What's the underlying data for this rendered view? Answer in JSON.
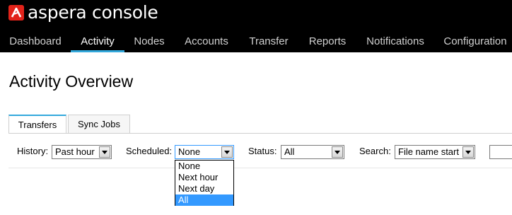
{
  "brand": {
    "name": "aspera console"
  },
  "nav": {
    "items": [
      {
        "label": "Dashboard",
        "active": false
      },
      {
        "label": "Activity",
        "active": true
      },
      {
        "label": "Nodes",
        "active": false
      },
      {
        "label": "Accounts",
        "active": false
      },
      {
        "label": "Transfer",
        "active": false
      },
      {
        "label": "Reports",
        "active": false
      },
      {
        "label": "Notifications",
        "active": false
      },
      {
        "label": "Configuration",
        "active": false
      }
    ]
  },
  "page": {
    "title": "Activity Overview"
  },
  "tabs": [
    {
      "label": "Transfers",
      "active": true
    },
    {
      "label": "Sync Jobs",
      "active": false
    }
  ],
  "filters": {
    "history": {
      "label": "History:",
      "value": "Past hour"
    },
    "scheduled": {
      "label": "Scheduled:",
      "value": "None",
      "open": true,
      "options": [
        "None",
        "Next hour",
        "Next day",
        "All"
      ],
      "highlighted": "All"
    },
    "status": {
      "label": "Status:",
      "value": "All"
    },
    "search": {
      "label": "Search:",
      "value": "File name start",
      "text": ""
    }
  },
  "colors": {
    "header_bg": "#000000",
    "accent": "#33a9dc",
    "selection": "#3399ff"
  },
  "icons": {
    "logo": "aspera-logo-icon",
    "dropdown_arrow": "chevron-down-icon"
  }
}
